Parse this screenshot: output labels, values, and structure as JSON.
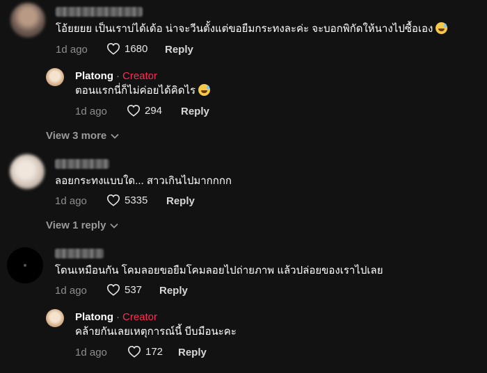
{
  "comments": [
    {
      "text": "โอ้ยยยย เป็นเราบ่ได้เด้อ น่าจะวีนตั้งแต่ขอยืมกระทงละค่ะ จะบอกพิกัดให้นางไปซื้อเอง",
      "time": "1d ago",
      "likes": "1680",
      "reply_label": "Reply",
      "creator_reply": {
        "name": "Platong",
        "badge": "Creator",
        "text": "ตอนแรกนี่ก็ไม่ค่อยได้คิดไร",
        "time": "1d ago",
        "likes": "294",
        "reply_label": "Reply"
      },
      "view_more": "View 3 more"
    },
    {
      "text": "ลอยกระทงแบบใด... สาวเกินไปมากกกก",
      "time": "1d ago",
      "likes": "5335",
      "reply_label": "Reply",
      "view_more": "View 1 reply"
    },
    {
      "text": "โดนเหมือนกัน โคมลอยขอยืมโคมลอยไปถ่ายภาพ แล้วปล่อยของเราไปเลย",
      "time": "1d ago",
      "likes": "537",
      "reply_label": "Reply",
      "creator_reply": {
        "name": "Platong",
        "badge": "Creator",
        "text": "คล้ายกันเลยเหตุการณ์นี้ บีบมือนะคะ",
        "time": "1d ago",
        "likes": "172",
        "reply_label": "Reply"
      }
    }
  ],
  "icons": {
    "like": "heart-outline-icon",
    "expand": "chevron-down-icon",
    "emoji": "grinning-sweat-emoji"
  },
  "colors": {
    "background": "#121212",
    "creator_badge": "#fe2c55",
    "muted": "#8e8e8e"
  }
}
